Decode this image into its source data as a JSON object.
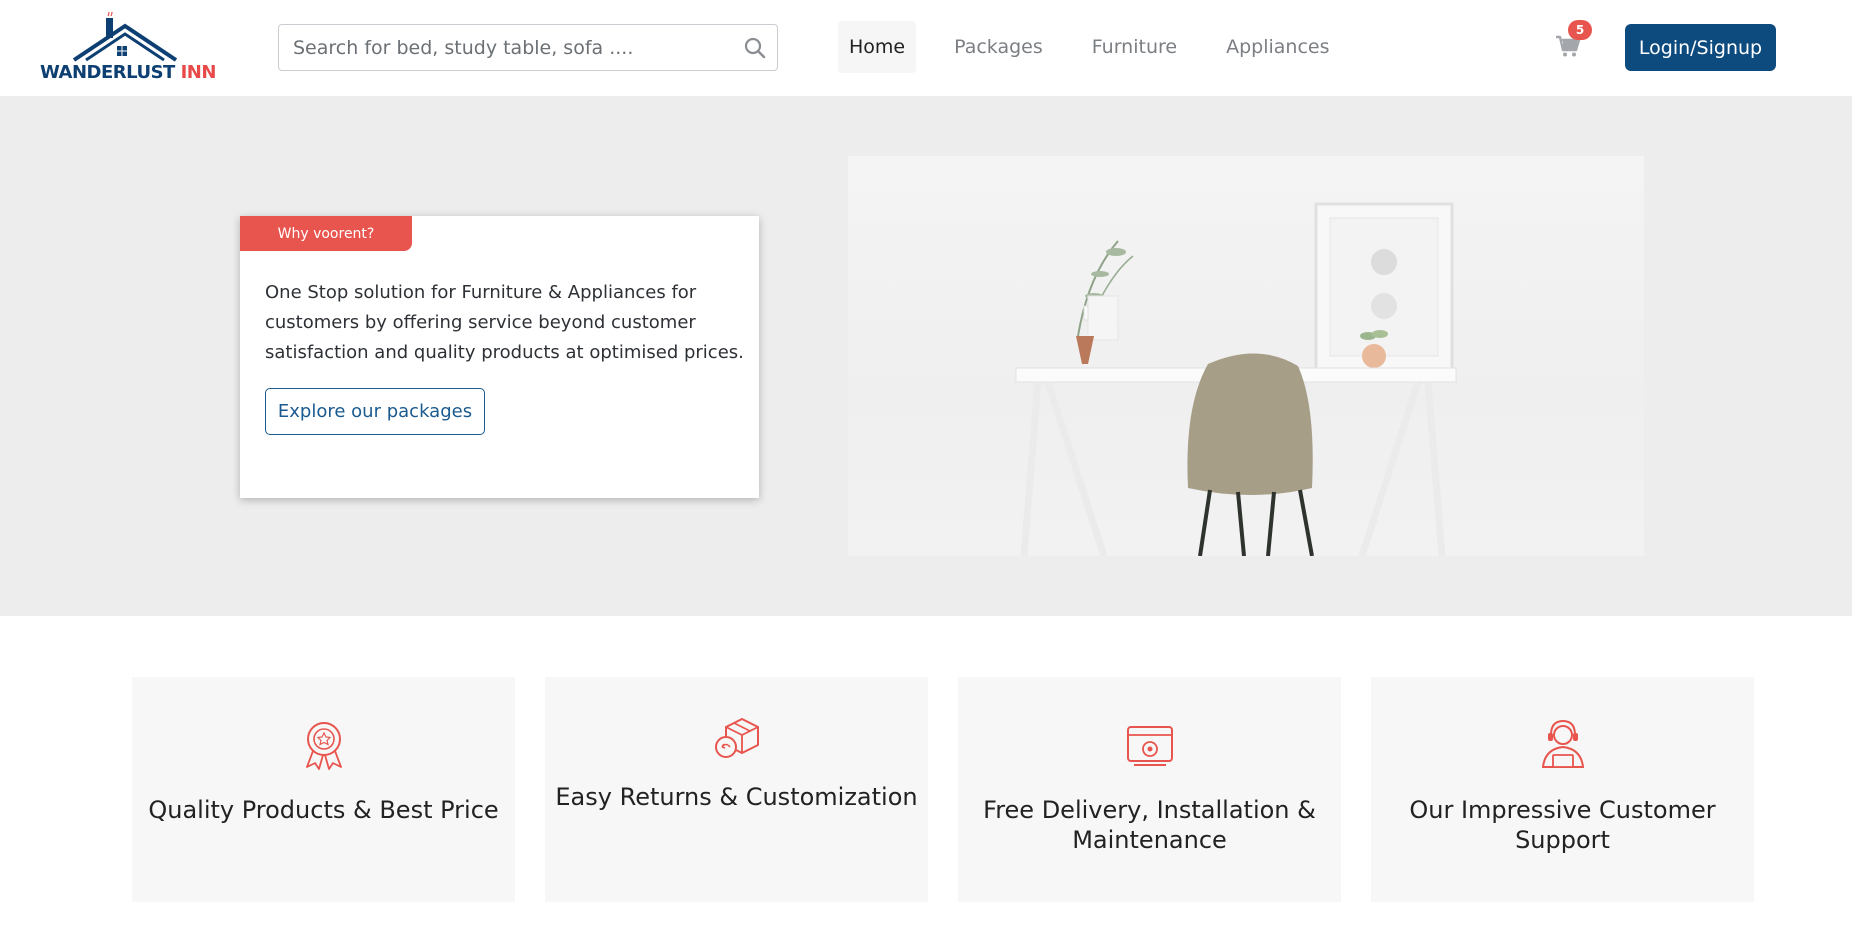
{
  "brand": {
    "name_part1": "WANDERLUST",
    "name_part2": "INN",
    "primary_color": "#0d3f73",
    "accent_color": "#e84a4a"
  },
  "search": {
    "placeholder": "Search for bed, study table, sofa ....",
    "icon": "search-icon"
  },
  "nav": {
    "items": [
      {
        "label": "Home",
        "active": true
      },
      {
        "label": "Packages",
        "active": false
      },
      {
        "label": "Furniture",
        "active": false
      },
      {
        "label": "Appliances",
        "active": false
      }
    ]
  },
  "cart": {
    "icon": "cart-icon",
    "count": "5"
  },
  "auth": {
    "login_label": "Login/Signup"
  },
  "hero": {
    "tag": "Why voorent?",
    "description": "One Stop solution for Furniture & Appliances for customers by offering service beyond customer satisfaction and quality products at optimised prices.",
    "cta_label": "Explore our packages"
  },
  "features": [
    {
      "icon": "award-ribbon-icon",
      "title": "Quality Products & Best Price"
    },
    {
      "icon": "return-box-icon",
      "title": "Easy Returns & Customization"
    },
    {
      "icon": "delivery-installation-icon",
      "title": "Free Delivery, Installation & Maintenance"
    },
    {
      "icon": "customer-support-icon",
      "title": "Our Impressive Customer Support"
    }
  ],
  "colors": {
    "button_primary": "#0d4a7e",
    "badge": "#e8554e",
    "hero_background": "#ededed",
    "feature_background": "#f7f7f7",
    "icon_accent": "#e8554e"
  }
}
